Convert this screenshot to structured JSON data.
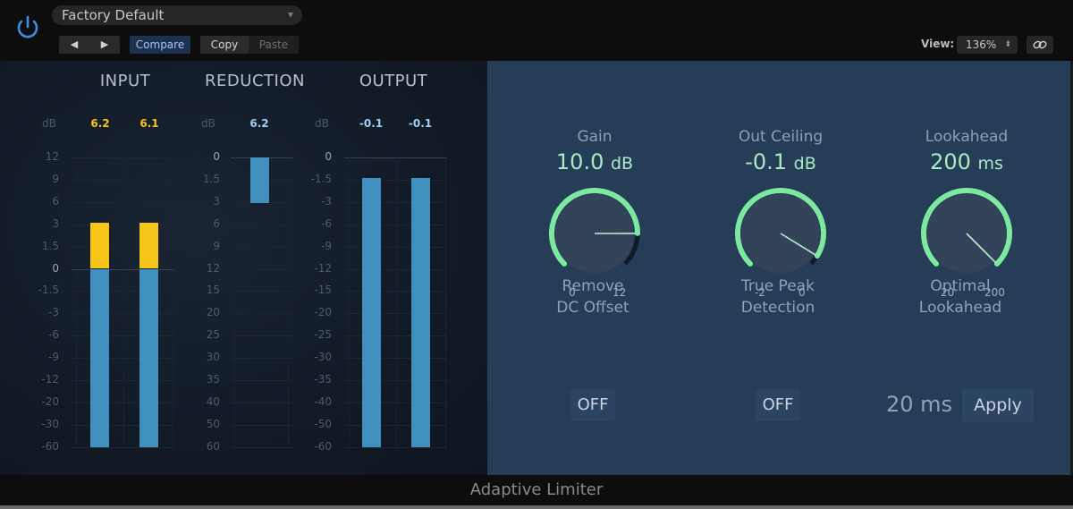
{
  "header": {
    "preset_name": "Factory Default",
    "prev_label": "◀",
    "next_label": "▶",
    "compare_label": "Compare",
    "copy_label": "Copy",
    "paste_label": "Paste",
    "view_label": "View:",
    "view_value": "136%",
    "link_icon": "🔗"
  },
  "meters": {
    "db_unit": "dB",
    "input": {
      "title": "INPUT",
      "peaks": [
        "6.2",
        "6.1"
      ],
      "ticks": [
        "12",
        "9",
        "6",
        "3",
        "1.5",
        "0",
        "-1.5",
        "-3",
        "-6",
        "-9",
        "-12",
        "-20",
        "-30",
        "-60"
      ],
      "levels_db": [
        3.2,
        3.2
      ],
      "peak_color": "#f5c518",
      "over_color": "#f5c518",
      "bar_color": "#3f8fbf"
    },
    "reduction": {
      "title": "REDUCTION",
      "peak": "6.2",
      "ticks": [
        "0",
        "1.5",
        "3",
        "6",
        "9",
        "12",
        "15",
        "20",
        "25",
        "30",
        "35",
        "40",
        "50",
        "60"
      ],
      "level_db": 3.2,
      "peak_color": "#9fd0f0",
      "bar_color": "#3f8fbf"
    },
    "output": {
      "title": "OUTPUT",
      "peaks": [
        "-0.1",
        "-0.1"
      ],
      "ticks": [
        "0",
        "-1.5",
        "-3",
        "-6",
        "-9",
        "-12",
        "-15",
        "-20",
        "-25",
        "-30",
        "-35",
        "-40",
        "-50",
        "-60"
      ],
      "levels_db": [
        -1.4,
        -1.4
      ],
      "peak_color": "#9fd0f0",
      "bar_color": "#3f8fbf"
    }
  },
  "controls": {
    "accent_color": "#7ee8a0",
    "knobs": [
      {
        "name": "Gain",
        "value": "10.0",
        "unit": "dB",
        "min_label": "0",
        "max_label": "12",
        "fraction": 0.833
      },
      {
        "name": "Out Ceiling",
        "value": "-0.1",
        "unit": "dB",
        "min_label": "-2",
        "max_label": "0",
        "fraction": 0.95
      },
      {
        "name": "Lookahead",
        "value": "200",
        "unit": "ms",
        "min_label": "20",
        "max_label": "200",
        "fraction": 1.0
      }
    ],
    "remove_dc": {
      "label_line1": "Remove",
      "label_line2": "DC Offset",
      "state": "OFF"
    },
    "true_peak": {
      "label_line1": "True Peak",
      "label_line2": "Detection",
      "state": "OFF"
    },
    "optimal_lookahead": {
      "label_line1": "Optimal",
      "label_line2": "Lookahead",
      "value": "20 ms",
      "apply_label": "Apply"
    }
  },
  "footer": {
    "plugin_name": "Adaptive Limiter"
  }
}
